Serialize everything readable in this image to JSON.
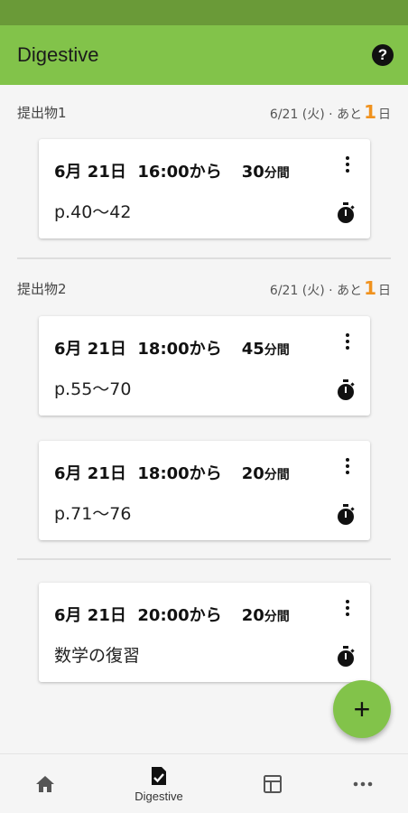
{
  "app_bar": {
    "title": "Digestive",
    "help_icon": "help-circle-icon"
  },
  "sections": [
    {
      "name": "提出物1",
      "due_text": "6/21 (火) · あと",
      "due_days": "1",
      "due_suffix": "日",
      "tasks": [
        {
          "date": "6月 21日",
          "time": "16:00から",
          "duration": "30",
          "duration_unit": "分間",
          "content": "p.40〜42"
        }
      ]
    },
    {
      "name": "提出物2",
      "due_text": "6/21 (火) · あと",
      "due_days": "1",
      "due_suffix": "日",
      "tasks": [
        {
          "date": "6月 21日",
          "time": "18:00から",
          "duration": "45",
          "duration_unit": "分間",
          "content": "p.55〜70"
        },
        {
          "date": "6月 21日",
          "time": "18:00から",
          "duration": "20",
          "duration_unit": "分間",
          "content": "p.71〜76"
        }
      ]
    },
    {
      "name": "",
      "tasks": [
        {
          "date": "6月 21日",
          "time": "20:00から",
          "duration": "20",
          "duration_unit": "分間",
          "content": "数学の復習"
        }
      ]
    }
  ],
  "fab": {
    "label": "+"
  },
  "bottom_nav": [
    {
      "icon": "home-icon",
      "label": ""
    },
    {
      "icon": "task-check-icon",
      "label": "Digestive"
    },
    {
      "icon": "calendar-grid-icon",
      "label": ""
    },
    {
      "icon": "more-horizontal-icon",
      "label": ""
    }
  ],
  "colors": {
    "primary": "#82c34a",
    "status_bar": "#6a9a38",
    "accent": "#f0921e",
    "background": "#f5f5f5"
  }
}
